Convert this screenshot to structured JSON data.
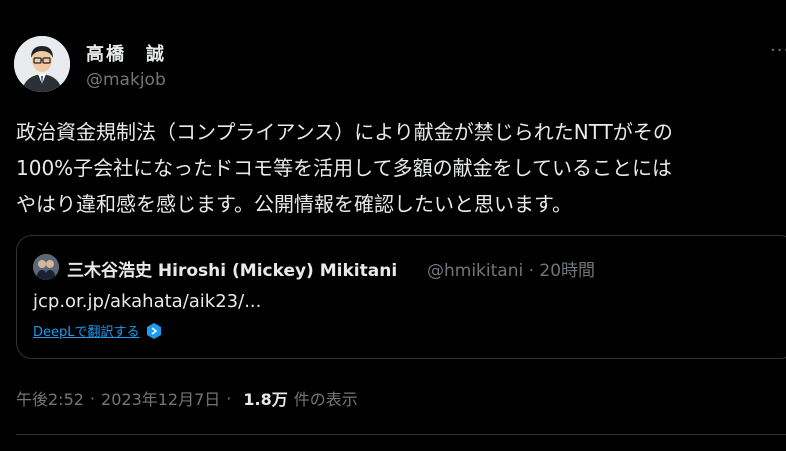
{
  "author": {
    "name": "高橋　誠",
    "handle": "@makjob"
  },
  "more_label": "···",
  "tweet": {
    "text": "政治資金規制法（コンプライアンス）により献金が禁じられたNTTがその\n100%子会社になったドコモ等を活用して多額の献金をしていることには\nやはり違和感を感じます。公開情報を確認したいと思います。"
  },
  "quote": {
    "author": "三木谷浩史 Hiroshi (Mickey) Mikitani",
    "handle_time": "@hmikitani · 20時間",
    "link": "jcp.or.jp/akahata/aik23/...",
    "translate_label": "DeepLで翻訳する"
  },
  "meta": {
    "time": "午後2:52",
    "date": "2023年12月7日",
    "separator": "·",
    "views": "1.8万",
    "views_label": "件の表示"
  },
  "colors": {
    "background": "#000000",
    "text": "#e7e9ea",
    "muted": "#71767b",
    "link": "#1d9bf0",
    "border": "#2f3336"
  }
}
